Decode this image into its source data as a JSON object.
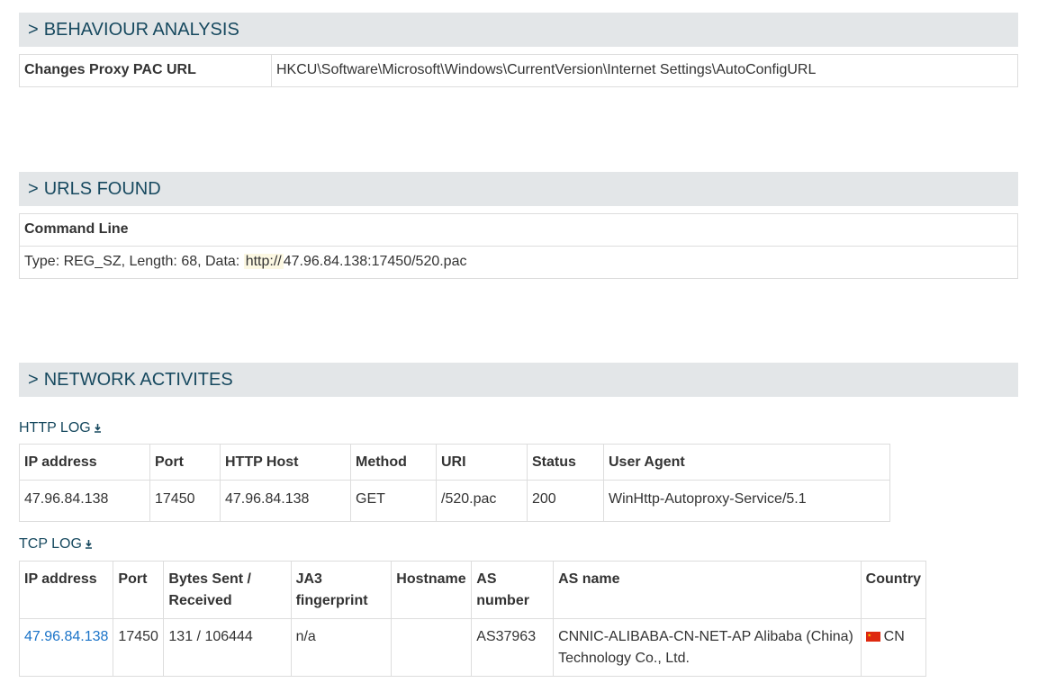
{
  "behaviour": {
    "header": "BEHAVIOUR ANALYSIS",
    "rows": [
      {
        "key": "Changes Proxy PAC URL",
        "value": "HKCU\\Software\\Microsoft\\Windows\\CurrentVersion\\Internet Settings\\AutoConfigURL"
      }
    ]
  },
  "urls": {
    "header": "URLS FOUND",
    "command_line_label": "Command Line",
    "entry_prefix": "Type: REG_SZ, Length: 68, Data:",
    "entry_highlight": "http://",
    "entry_rest": "47.96.84.138:17450/520.pac"
  },
  "network": {
    "header": "NETWORK ACTIVITES",
    "http_log": {
      "title": "HTTP LOG",
      "columns": [
        "IP address",
        "Port",
        "HTTP Host",
        "Method",
        "URI",
        "Status",
        "User Agent"
      ],
      "rows": [
        [
          "47.96.84.138",
          "17450",
          "47.96.84.138",
          "GET",
          "/520.pac",
          "200",
          "WinHttp-Autoproxy-Service/5.1"
        ]
      ]
    },
    "tcp_log": {
      "title": "TCP LOG",
      "columns": [
        "IP address",
        "Port",
        "Bytes Sent / Received",
        "JA3 fingerprint",
        "Hostname",
        "AS number",
        "AS name",
        "Country"
      ],
      "rows": [
        {
          "ip": "47.96.84.138",
          "port": "17450",
          "bytes": "131 / 106444",
          "ja3": "n/a",
          "hostname": "",
          "as_number": "AS37963",
          "as_name": "CNNIC-ALIBABA-CN-NET-AP Alibaba (China) Technology Co., Ltd.",
          "country": "CN",
          "flag_icon": "flag-cn-icon"
        }
      ]
    }
  },
  "colors": {
    "header_bg": "#e3e6e8",
    "header_text": "#17495f",
    "link": "#1a73c8",
    "highlight": "#fcf8e3"
  }
}
